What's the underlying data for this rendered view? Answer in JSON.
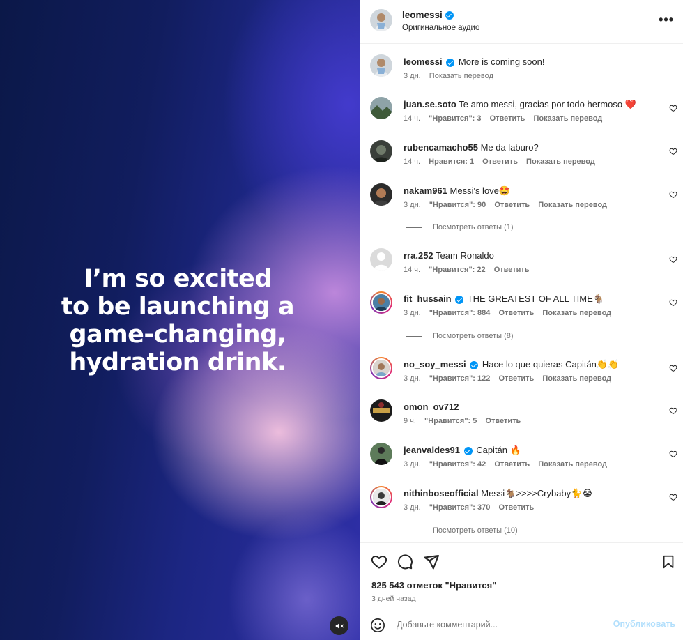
{
  "media": {
    "headline": "I’m so excited to be launching a game-changing, hydration drink.",
    "headline_lines": [
      "I’m so excited",
      "to be launching a",
      "game-changing,",
      "hydration drink."
    ],
    "mute_icon": "speaker-muted-icon"
  },
  "header": {
    "username": "leomessi",
    "subtitle": "Оригинальное аудио",
    "more_icon": "more-horizontal-icon"
  },
  "caption": {
    "username": "leomessi",
    "text": "More is coming soon!",
    "time": "3 дн.",
    "translate": "Показать перевод"
  },
  "comments": [
    {
      "username": "juan.se.soto",
      "verified": false,
      "text": "Te amo messi, gracias por todo hermoso ❤️",
      "time": "14 ч.",
      "likes": "\"Нравится\": 3",
      "reply": "Ответить",
      "translate": "Показать перевод"
    },
    {
      "username": "rubencamacho55",
      "verified": false,
      "text": "Me da laburo?",
      "time": "14 ч.",
      "likes": "Нравится: 1",
      "reply": "Ответить",
      "translate": "Показать перевод"
    },
    {
      "username": "nakam961",
      "verified": false,
      "text": "Messi's love🤩",
      "time": "3 дн.",
      "likes": "\"Нравится\": 90",
      "reply": "Ответить",
      "translate": "Показать перевод",
      "view_replies": "Посмотреть ответы (1)"
    },
    {
      "username": "rra.252",
      "verified": false,
      "text": "Team Ronaldo",
      "time": "14 ч.",
      "likes": "\"Нравится\": 22",
      "reply": "Ответить"
    },
    {
      "username": "fit_hussain",
      "verified": true,
      "text": "THE GREATEST OF ALL TIME🐐",
      "time": "3 дн.",
      "likes": "\"Нравится\": 884",
      "reply": "Ответить",
      "translate": "Показать перевод",
      "view_replies": "Посмотреть ответы (8)"
    },
    {
      "username": "no_soy_messi",
      "verified": true,
      "text": "Hace lo que quieras Capitán👏👏",
      "time": "3 дн.",
      "likes": "\"Нравится\": 122",
      "reply": "Ответить",
      "translate": "Показать перевод"
    },
    {
      "username": "omon_ov712",
      "verified": false,
      "text": "",
      "time": "9 ч.",
      "likes": "\"Нравится\": 5",
      "reply": "Ответить"
    },
    {
      "username": "jeanvaldes91",
      "verified": true,
      "text": "Capitán 🔥",
      "time": "3 дн.",
      "likes": "\"Нравится\": 42",
      "reply": "Ответить",
      "translate": "Показать перевод"
    },
    {
      "username": "nithinboseofficial",
      "verified": false,
      "text": "Messi🐐>>>>Crybaby🐈😭",
      "time": "3 дн.",
      "likes": "\"Нравится\": 370",
      "reply": "Ответить",
      "view_replies": "Посмотреть ответы (10)"
    }
  ],
  "actions": {
    "like_icon": "heart-icon",
    "comment_icon": "comment-bubble-icon",
    "share_icon": "paper-plane-icon",
    "save_icon": "bookmark-icon",
    "likes": "825 543 отметок \"Нравится\"",
    "time": "3 дней назад"
  },
  "add_comment": {
    "emoji_icon": "emoji-smile-icon",
    "placeholder": "Добавьте комментарий...",
    "publish": "Опубликовать"
  },
  "colors": {
    "accent": "#0095f6",
    "publish_disabled": "#b2dffc",
    "heart_red": "#ed4956",
    "muted_text": "#737373"
  }
}
